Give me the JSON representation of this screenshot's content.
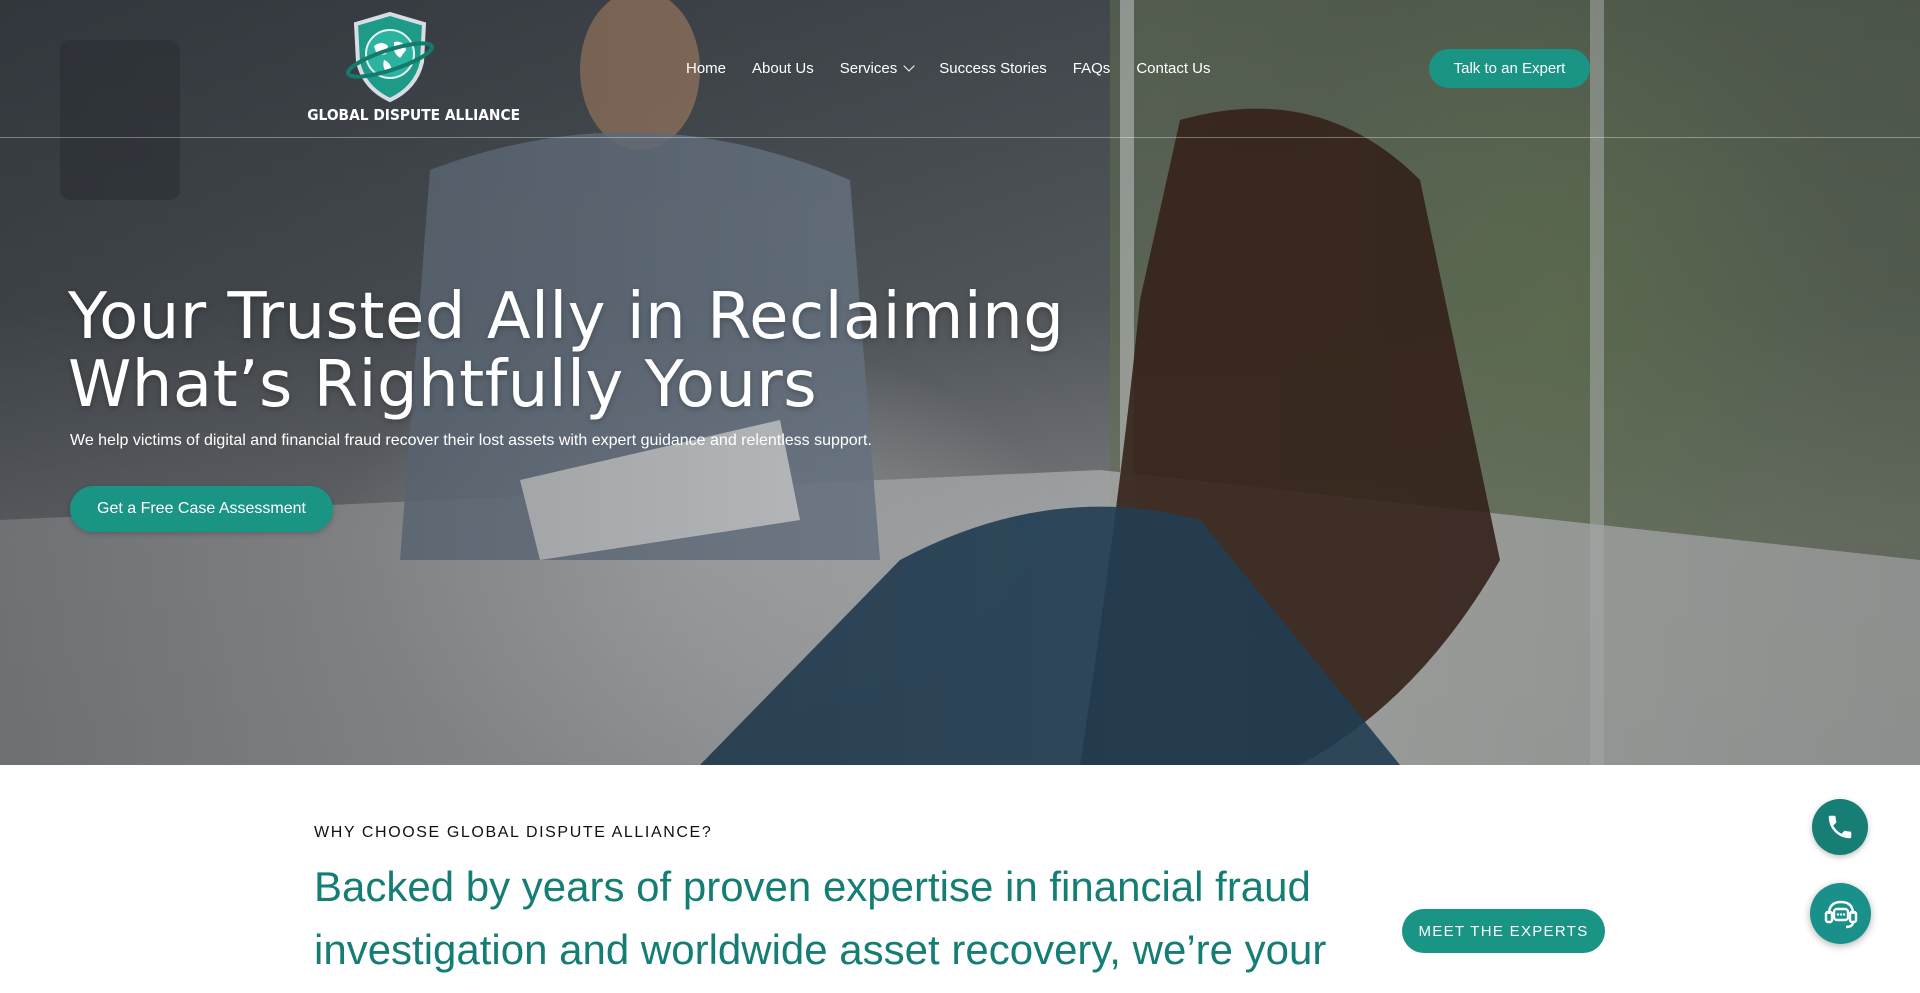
{
  "header": {
    "logo_text": "GLOBAL DISPUTE ALLIANCE",
    "nav": [
      {
        "label": "Home"
      },
      {
        "label": "About Us"
      },
      {
        "label": "Services"
      },
      {
        "label": "Success Stories"
      },
      {
        "label": "FAQs"
      },
      {
        "label": "Contact Us"
      }
    ],
    "cta_label": "Talk to an Expert"
  },
  "hero": {
    "title_line1": "Your Trusted Ally in Reclaiming",
    "title_line2": "What’s Rightfully Yours",
    "subtitle": "We help victims of digital and financial fraud recover their lost assets with expert guidance and relentless support.",
    "cta_label": "Get a Free Case Assessment"
  },
  "why": {
    "eyebrow": "WHY CHOOSE GLOBAL DISPUTE ALLIANCE?",
    "heading": "Backed by years of proven expertise in financial fraud investigation and worldwide asset recovery, we’re your",
    "cta_label": "MEET THE EXPERTS"
  },
  "icons": {
    "services_dropdown": "chevron-down-icon",
    "logo": "globe-shield-icon",
    "floating_phone": "phone-icon",
    "floating_chat": "chat-support-icon"
  },
  "colors": {
    "accent": "#1a9484",
    "heading_teal": "#157e74",
    "text_dark": "#111111",
    "white": "#ffffff"
  }
}
